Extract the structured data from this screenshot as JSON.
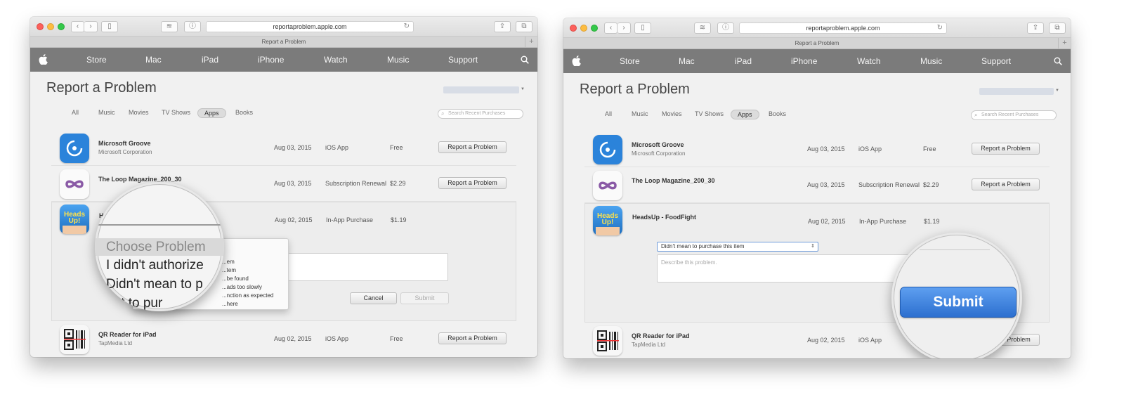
{
  "browser": {
    "url": "reportaproblem.apple.com",
    "tab_title": "Report a Problem"
  },
  "nav": {
    "items": [
      "Store",
      "Mac",
      "iPad",
      "iPhone",
      "Watch",
      "Music",
      "Support"
    ]
  },
  "page": {
    "title": "Report a Problem",
    "filters": [
      "All",
      "Music",
      "Movies",
      "TV Shows",
      "Apps",
      "Books"
    ],
    "active_filter": "Apps",
    "search_placeholder": "Search Recent Purchases",
    "report_button": "Report a Problem"
  },
  "purchases": [
    {
      "name": "Microsoft Groove",
      "developer": "Microsoft Corporation",
      "date": "Aug 03, 2015",
      "type": "iOS App",
      "price": "Free",
      "icon": "microsoft-groove-icon"
    },
    {
      "name": "The Loop Magazine_200_30",
      "developer": "",
      "date": "Aug 03, 2015",
      "type": "Subscription Renewal",
      "price": "$2.29",
      "icon": "the-loop-icon"
    },
    {
      "name": "HeadsUp - FoodFight",
      "developer": "",
      "date": "Aug 02, 2015",
      "type": "In-App Purchase",
      "price": "$1.19",
      "icon": "heads-up-icon"
    },
    {
      "name": "QR Reader for iPad",
      "developer": "TapMedia Ltd",
      "date": "Aug 02, 2015",
      "type": "iOS App",
      "price": "Free",
      "icon": "qr-reader-icon"
    }
  ],
  "left_form": {
    "dropdown_items": [
      "Choose Problem",
      "...em",
      "...tem",
      "...be found",
      "...ads too slowly",
      "...nction as expected",
      "...here"
    ],
    "cancel_label": "Cancel",
    "submit_label": "Submit",
    "name_partial": "H"
  },
  "left_magnifier": {
    "line1": "Choose Problem",
    "line2": "I didn't authorize",
    "line3": "Didn't mean to p",
    "line4": "ent to pur"
  },
  "right_form": {
    "selected_problem": "Didn't mean to purchase this item",
    "textarea_placeholder": "Describe this problem.",
    "submit_label": "Submit"
  },
  "icon_colors": {
    "groove": "#2b83da",
    "loop": "#8a5aa6",
    "headsup": "#2f7fd0"
  }
}
